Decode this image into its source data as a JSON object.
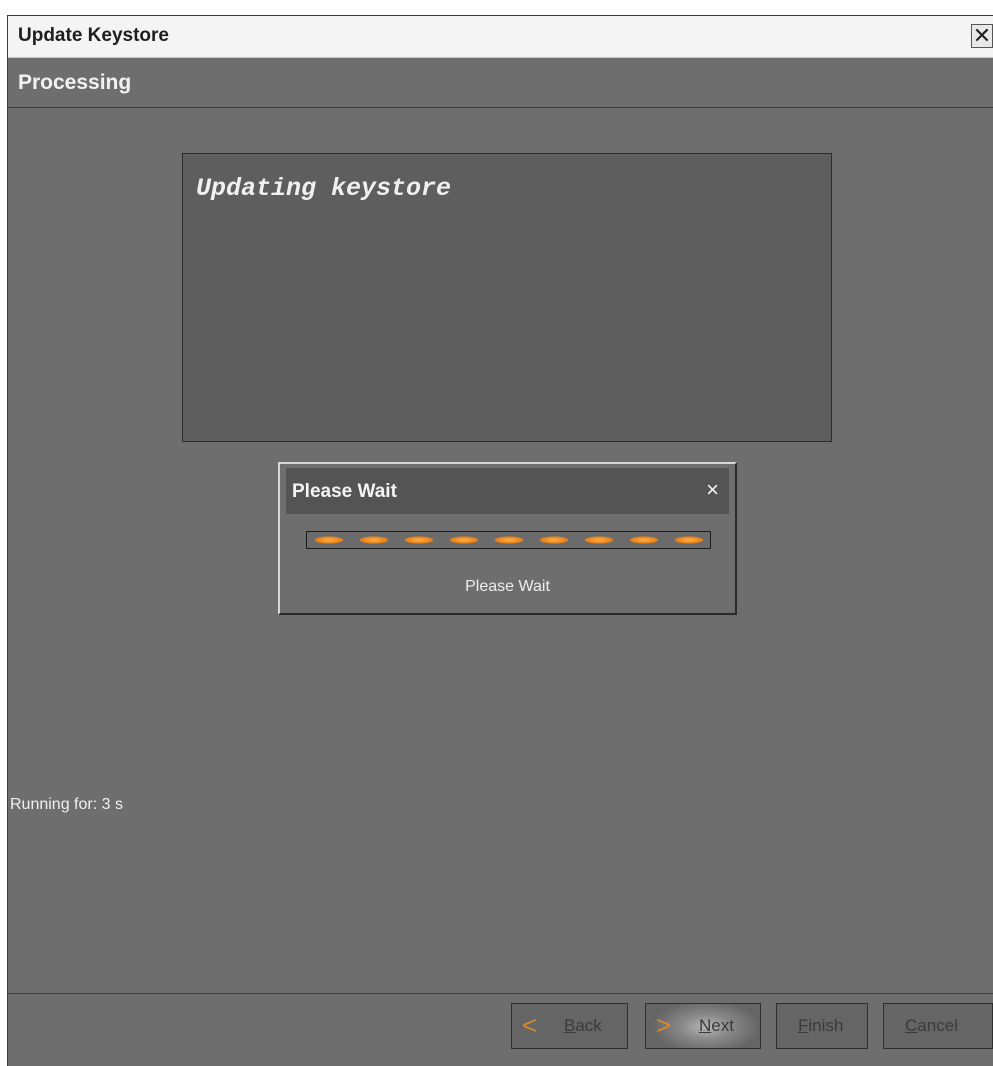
{
  "window": {
    "title": "Update Keystore",
    "close_glyph": "✕"
  },
  "header": {
    "heading": "Processing"
  },
  "console": {
    "message": "Updating keystore"
  },
  "wait_dialog": {
    "title": "Please Wait",
    "close_glyph": "×",
    "status": "Please Wait",
    "progress": "indeterminate"
  },
  "status_line": "Running for: 3 s",
  "buttons": {
    "back": {
      "chevron": "<",
      "mnemonic": "B",
      "rest": "ack"
    },
    "next": {
      "chevron": ">",
      "mnemonic": "N",
      "rest": "ext"
    },
    "finish": {
      "mnemonic": "F",
      "rest": "inish"
    },
    "cancel": {
      "mnemonic": "C",
      "rest": "ancel"
    }
  },
  "colors": {
    "accent": "#e27a14",
    "panel": "#6e6e6e",
    "console_bg": "#5e5e5e"
  }
}
